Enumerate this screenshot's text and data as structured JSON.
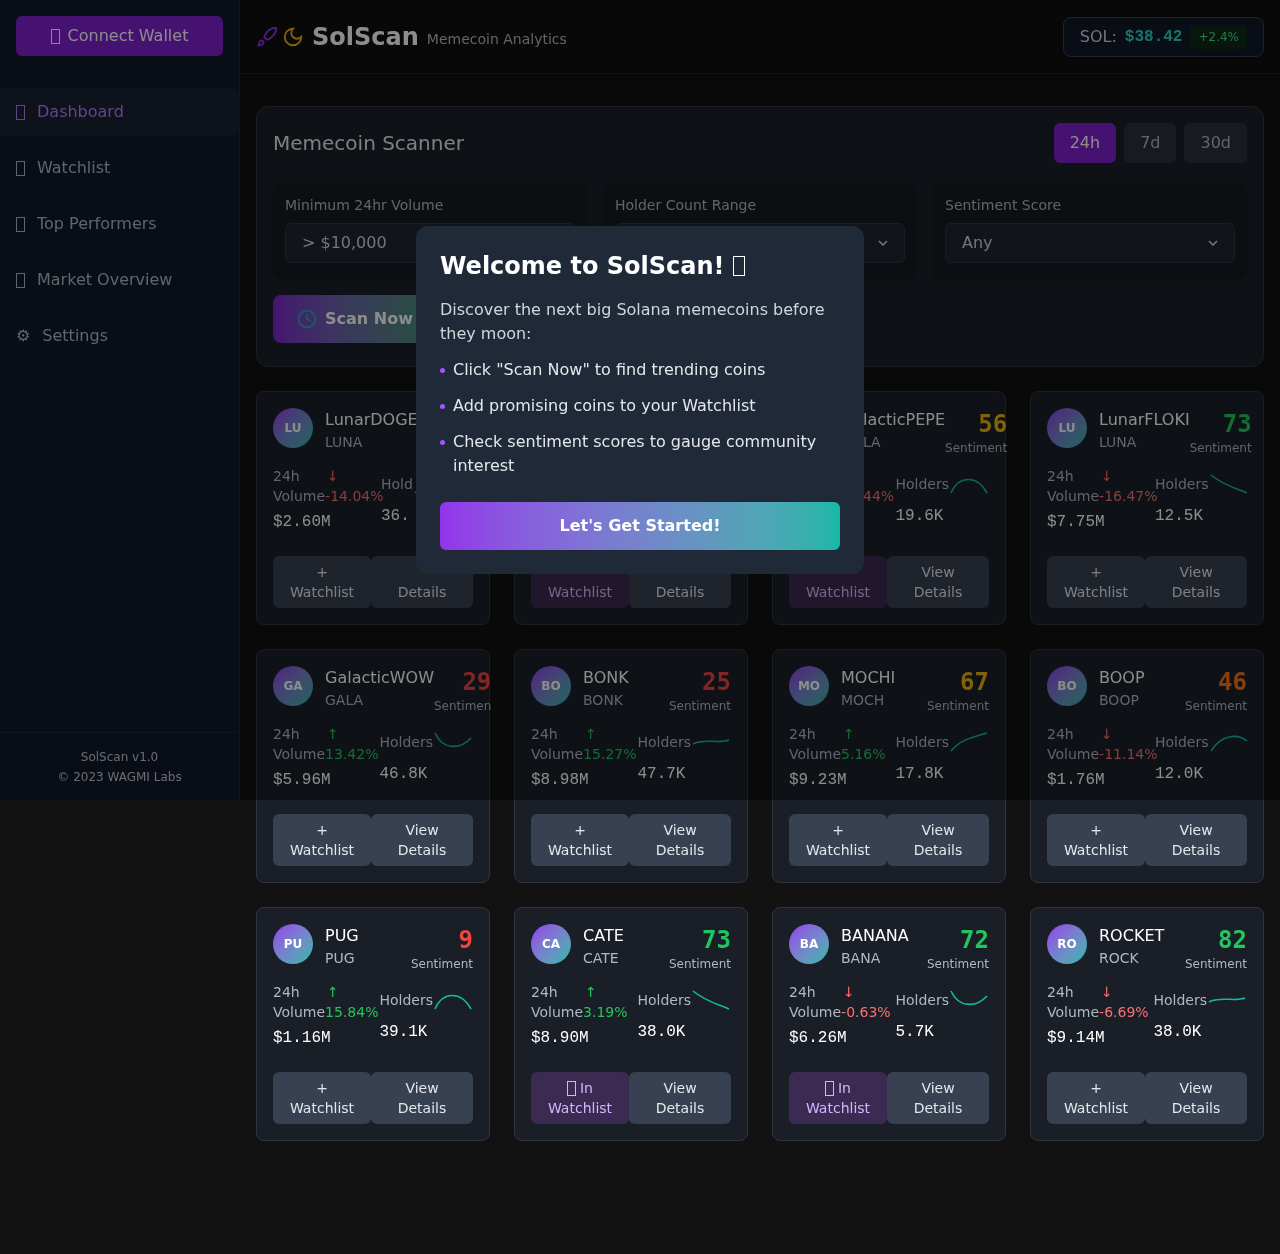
{
  "sidebar": {
    "connect_button": "Connect Wallet",
    "items": [
      {
        "label": "Dashboard",
        "selected": true
      },
      {
        "label": "Watchlist",
        "selected": false
      },
      {
        "label": "Top Performers",
        "selected": false
      },
      {
        "label": "Market Overview",
        "selected": false
      },
      {
        "label": "Settings",
        "glyph": "⚙",
        "selected": false
      }
    ],
    "footer": [
      "SolScan v1.0",
      "© 2023 WAGMI Labs"
    ]
  },
  "header": {
    "title": "SolScan",
    "subtitle": "Memecoin Analytics",
    "price_label": "SOL:",
    "price": "$38.42",
    "change": "+2.4%"
  },
  "scanner": {
    "title": "Memecoin Scanner",
    "periods": [
      {
        "label": "24h",
        "selected": true
      },
      {
        "label": "7d",
        "selected": false
      },
      {
        "label": "30d",
        "selected": false
      }
    ],
    "filters": [
      {
        "label": "Minimum 24hr Volume",
        "value": "> $10,000"
      },
      {
        "label": "Holder Count Range"
      },
      {
        "label": "Sentiment Score",
        "value": "Any"
      }
    ],
    "scan_button": "Scan Now"
  },
  "coins": [
    {
      "initials": "LU",
      "name": "LunarDOGE",
      "symbol": "LUNA",
      "period": "24h",
      "arrow": "↓",
      "rising": false,
      "volume_label": "Volume",
      "change": "-14.04%",
      "volume": "$2.60M",
      "holders_label": "Hold",
      "holders": "36.",
      "watchlisted": false,
      "watch_label": [
        "+",
        "Watchlist"
      ],
      "details_label": [
        "Details"
      ]
    },
    {
      "watchlisted": true,
      "watch_label": [
        "Watchlist"
      ],
      "details_label": [
        "Details"
      ]
    },
    {
      "name": "lacticPEPE",
      "symbol": "LA",
      "score": "56",
      "color": "#816206",
      "sentiment_label": "Sentiment",
      "change": "44%",
      "rising": false,
      "holders_label": "Holders",
      "holders": "19.6K",
      "watchlisted": true,
      "watch_label": [
        "Watchlist"
      ],
      "details_label": [
        "View",
        "Details"
      ]
    },
    {
      "initials": "LU",
      "name": "LunarFLOKI",
      "symbol": "LUNA",
      "score": "73",
      "color": "#136c34",
      "sentiment_label": "Sentiment",
      "period": "24h",
      "arrow": "↓",
      "rising": false,
      "volume_label": "Volume",
      "change": "-16.47%",
      "volume": "$7.75M",
      "holders_label": "Holders",
      "holders": "12.5K",
      "watchlisted": false,
      "watch_label": [
        "+",
        "Watchlist"
      ],
      "details_label": [
        "View",
        "Details"
      ]
    },
    {
      "initials": "GA",
      "name": "GalacticWOW",
      "symbol": "GALA",
      "score": "29",
      "color": "#832525",
      "sentiment_label": "Sentimen",
      "period": "24h",
      "arrow": "↑",
      "rising": true,
      "volume_label": "Volume",
      "change": "13.42%",
      "volume": "$5.96M",
      "holders_label": "Holders",
      "holders": "46.8K",
      "watchlisted": false,
      "watch_label": [
        "+",
        "Watchlist"
      ],
      "details_label": [
        "View",
        "Details"
      ]
    },
    {
      "initials": "BO",
      "name": "BONK",
      "symbol": "BONK",
      "score": "25",
      "color": "#832525",
      "sentiment_label": "Sentiment",
      "period": "24h",
      "arrow": "↑",
      "rising": true,
      "volume_label": "Volume",
      "change": "15.27%",
      "volume": "$8.98M",
      "holders_label": "Holders",
      "holders": "47.7K",
      "watchlisted": false,
      "watch_label": [
        "+",
        "Watchlist"
      ],
      "details_label": [
        "View",
        "Details"
      ]
    },
    {
      "initials": "MO",
      "name": "MOCHI",
      "symbol": "MOCH",
      "score": "67",
      "color": "#816206",
      "sentiment_label": "Sentiment",
      "period": "24h",
      "arrow": "↑",
      "rising": true,
      "volume_label": "Volume",
      "change": "5.16%",
      "volume": "$9.23M",
      "holders_label": "Holders",
      "holders": "17.8K",
      "watchlisted": false,
      "watch_label": [
        "+",
        "Watchlist"
      ],
      "details_label": [
        "View",
        "Details"
      ]
    },
    {
      "initials": "BO",
      "name": "BOOP",
      "symbol": "BOOP",
      "score": "46",
      "color": "#893f0c",
      "sentiment_label": "Sentiment",
      "period": "24h",
      "arrow": "↓",
      "rising": false,
      "volume_label": "Volume",
      "change": "-11.14%",
      "volume": "$1.76M",
      "holders_label": "Holders",
      "holders": "12.0K",
      "watchlisted": false,
      "watch_label": [
        "+",
        "Watchlist"
      ],
      "details_label": [
        "View",
        "Details"
      ]
    },
    {
      "initials": "PU",
      "name": "PUG",
      "symbol": "PUG",
      "score": "9",
      "color": "#ef4444",
      "sentiment_label": "Sentiment",
      "period": "24h",
      "arrow": "↑",
      "rising": true,
      "volume_label": "Volume",
      "change": "15.84%",
      "volume": "$1.16M",
      "holders_label": "Holders",
      "holders": "39.1K",
      "watchlisted": false,
      "watch_label": [
        "+",
        "Watchlist"
      ],
      "details_label": [
        "View",
        "Details"
      ]
    },
    {
      "initials": "CA",
      "name": "CATE",
      "symbol": "CATE",
      "score": "73",
      "color": "#22c55e",
      "sentiment_label": "Sentiment",
      "period": "24h",
      "arrow": "↑",
      "rising": true,
      "volume_label": "Volume",
      "change": "3.19%",
      "volume": "$8.90M",
      "holders_label": "Holders",
      "holders": "38.0K",
      "watchlisted": true,
      "watch_label": [
        "In",
        "Watchlist"
      ],
      "details_label": [
        "View",
        "Details"
      ]
    },
    {
      "initials": "BA",
      "name": "BANANA",
      "symbol": "BANA",
      "score": "72",
      "color": "#22c55e",
      "sentiment_label": "Sentiment",
      "period": "24h",
      "arrow": "↓",
      "rising": false,
      "volume_label": "Volume",
      "change": "-0.63%",
      "volume": "$6.26M",
      "holders_label": "Holders",
      "holders": "5.7K",
      "watchlisted": true,
      "watch_label": [
        "In",
        "Watchlist"
      ],
      "details_label": [
        "View",
        "Details"
      ]
    },
    {
      "initials": "RO",
      "name": "ROCKET",
      "symbol": "ROCK",
      "score": "82",
      "color": "#22c55e",
      "sentiment_label": "Sentiment",
      "period": "24h",
      "arrow": "↓",
      "rising": false,
      "volume_label": "Volume",
      "change": "-6.69%",
      "volume": "$9.14M",
      "holders_label": "Holders",
      "holders": "38.0K",
      "watchlisted": false,
      "watch_label": [
        "+",
        "Watchlist"
      ],
      "details_label": [
        "View",
        "Details"
      ]
    }
  ],
  "modal": {
    "title": "Welcome to SolScan!",
    "intro": "Discover the next big Solana memecoins before they moon:",
    "bullets": [
      "Click \"Scan Now\" to find trending coins",
      "Add promising coins to your Watchlist",
      "Check sentiment scores to gauge community interest"
    ],
    "button": "Let's Get Started!"
  }
}
